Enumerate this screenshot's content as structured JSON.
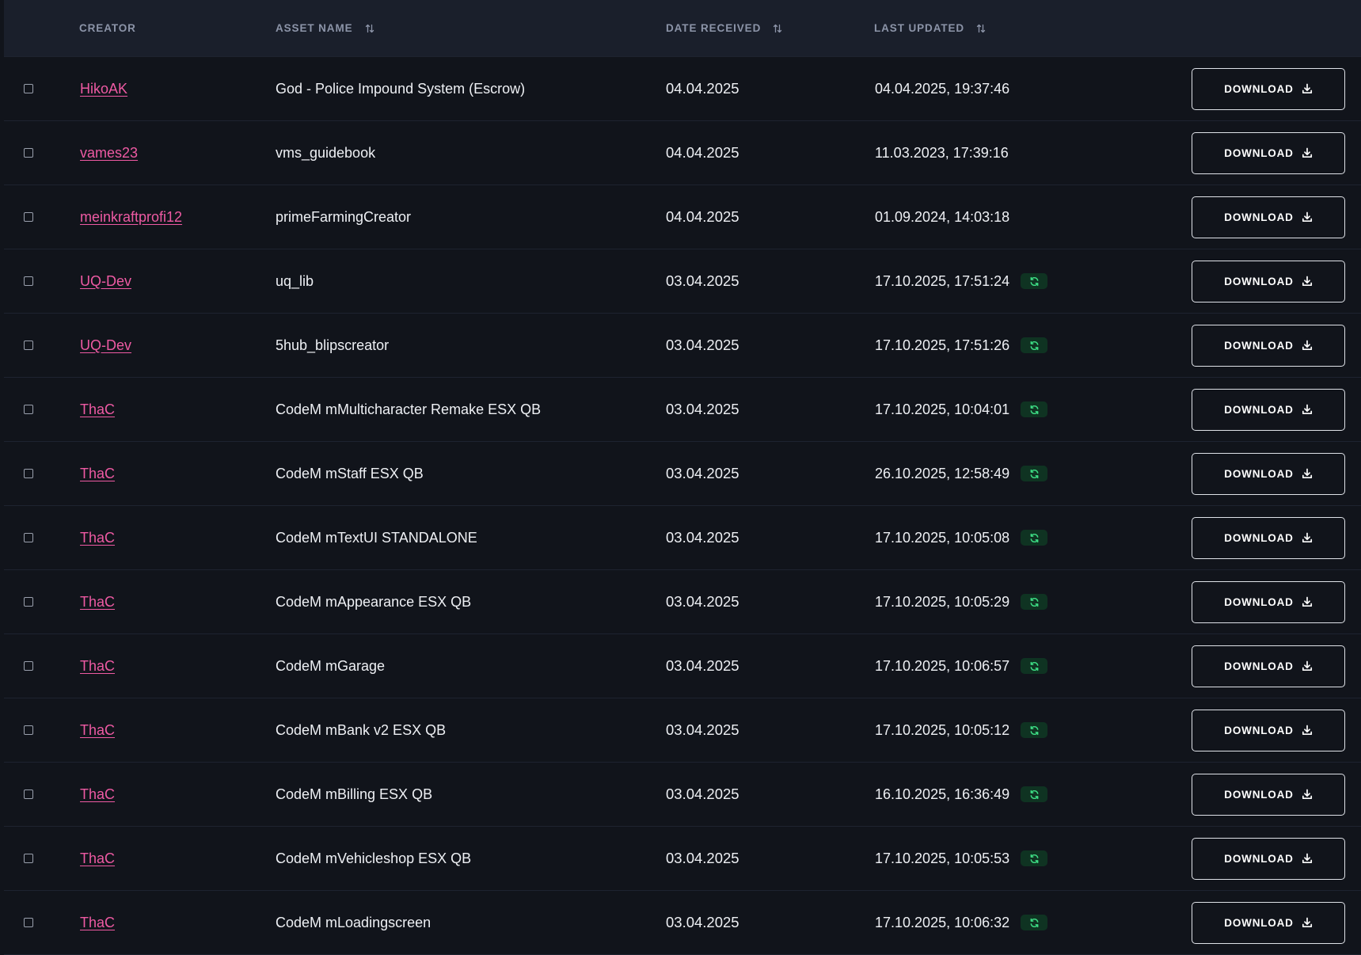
{
  "header": {
    "creator": "CREATOR",
    "asset_name": "ASSET NAME",
    "date_received": "DATE RECEIVED",
    "last_updated": "LAST UPDATED"
  },
  "colors": {
    "creator_link": "#ee5aa3",
    "header_bg": "#1a1f2b",
    "row_bg": "#11141b",
    "update_badge_bg": "#0f3322",
    "update_icon": "#3ddc84"
  },
  "download_label": "DOWNLOAD",
  "rows": [
    {
      "creator": "HikoAK",
      "asset": "God - Police Impound System (Escrow)",
      "date": "04.04.2025",
      "updated": "04.04.2025, 19:37:46",
      "has_update": false
    },
    {
      "creator": "vames23",
      "asset": "vms_guidebook",
      "date": "04.04.2025",
      "updated": "11.03.2023, 17:39:16",
      "has_update": false
    },
    {
      "creator": "meinkraftprofi12",
      "asset": "primeFarmingCreator",
      "date": "04.04.2025",
      "updated": "01.09.2024, 14:03:18",
      "has_update": false
    },
    {
      "creator": "UQ-Dev",
      "asset": "uq_lib",
      "date": "03.04.2025",
      "updated": "17.10.2025, 17:51:24",
      "has_update": true
    },
    {
      "creator": "UQ-Dev",
      "asset": "5hub_blipscreator",
      "date": "03.04.2025",
      "updated": "17.10.2025, 17:51:26",
      "has_update": true
    },
    {
      "creator": "ThaC",
      "asset": "CodeM mMulticharacter Remake ESX QB",
      "date": "03.04.2025",
      "updated": "17.10.2025, 10:04:01",
      "has_update": true
    },
    {
      "creator": "ThaC",
      "asset": "CodeM mStaff ESX QB",
      "date": "03.04.2025",
      "updated": "26.10.2025, 12:58:49",
      "has_update": true
    },
    {
      "creator": "ThaC",
      "asset": "CodeM mTextUI STANDALONE",
      "date": "03.04.2025",
      "updated": "17.10.2025, 10:05:08",
      "has_update": true
    },
    {
      "creator": "ThaC",
      "asset": "CodeM mAppearance ESX QB",
      "date": "03.04.2025",
      "updated": "17.10.2025, 10:05:29",
      "has_update": true
    },
    {
      "creator": "ThaC",
      "asset": "CodeM mGarage",
      "date": "03.04.2025",
      "updated": "17.10.2025, 10:06:57",
      "has_update": true
    },
    {
      "creator": "ThaC",
      "asset": "CodeM mBank v2 ESX QB",
      "date": "03.04.2025",
      "updated": "17.10.2025, 10:05:12",
      "has_update": true
    },
    {
      "creator": "ThaC",
      "asset": "CodeM mBilling ESX QB",
      "date": "03.04.2025",
      "updated": "16.10.2025, 16:36:49",
      "has_update": true
    },
    {
      "creator": "ThaC",
      "asset": "CodeM mVehicleshop ESX QB",
      "date": "03.04.2025",
      "updated": "17.10.2025, 10:05:53",
      "has_update": true
    },
    {
      "creator": "ThaC",
      "asset": "CodeM mLoadingscreen",
      "date": "03.04.2025",
      "updated": "17.10.2025, 10:06:32",
      "has_update": true
    }
  ]
}
